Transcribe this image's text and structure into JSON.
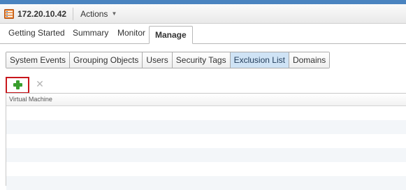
{
  "header": {
    "host_title": "172.20.10.42",
    "actions_label": "Actions",
    "host_icon": "host-server-icon",
    "caret_icon": "caret-down-icon"
  },
  "main_tabs": [
    {
      "label": "Getting Started",
      "active": false
    },
    {
      "label": "Summary",
      "active": false
    },
    {
      "label": "Monitor",
      "active": false
    },
    {
      "label": "Manage",
      "active": true
    }
  ],
  "sub_tabs": [
    {
      "label": "System Events",
      "active": false
    },
    {
      "label": "Grouping Objects",
      "active": false
    },
    {
      "label": "Users",
      "active": false
    },
    {
      "label": "Security Tags",
      "active": false
    },
    {
      "label": "Exclusion List",
      "active": true
    },
    {
      "label": "Domains",
      "active": false
    }
  ],
  "toolbar": {
    "add_icon": "plus-icon",
    "delete_icon": "delete-x-icon",
    "delete_glyph": "✕"
  },
  "grid": {
    "column_header": "Virtual Machine",
    "rows": []
  },
  "colors": {
    "accent": "#4a84c0",
    "selected_subtab": "#cfe3f5",
    "highlight_border": "#c8171c",
    "add_icon": "#3a9e2e"
  }
}
